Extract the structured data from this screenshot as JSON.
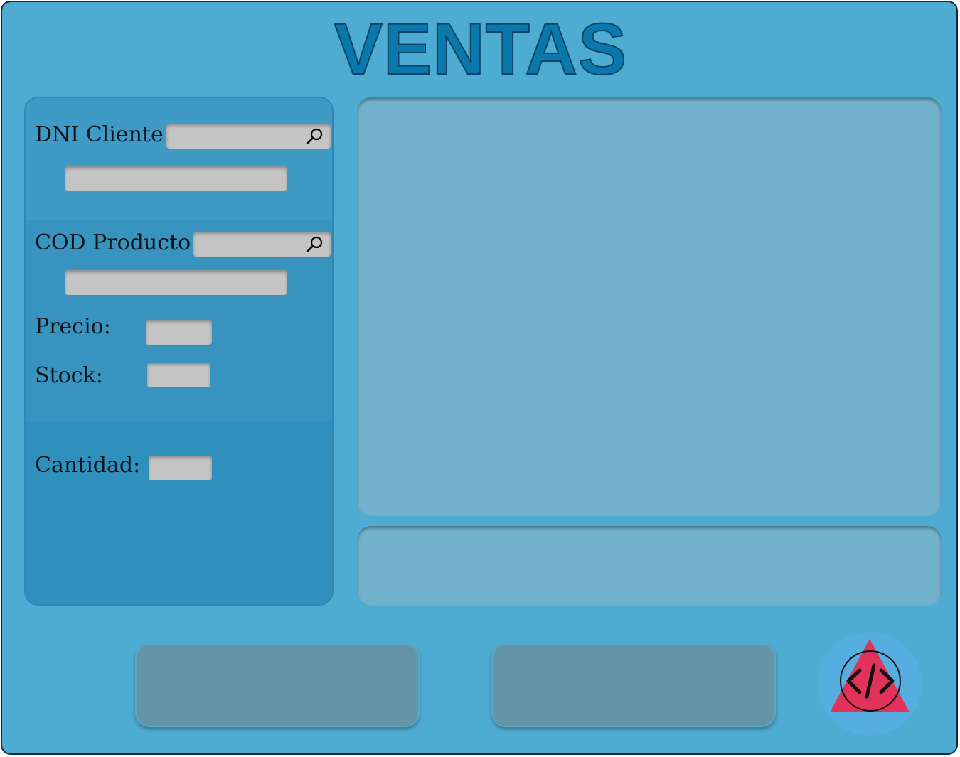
{
  "title": "VENTAS",
  "cliente": {
    "dni_label": "DNI Cliente:",
    "dni_value": "",
    "nombre_value": ""
  },
  "producto": {
    "cod_label": "COD Producto:",
    "cod_value": "",
    "descripcion_value": "",
    "precio_label": "Precio:",
    "precio_value": "",
    "stock_label": "Stock:",
    "stock_value": ""
  },
  "cantidad": {
    "label": "Cantidad:",
    "value": ""
  },
  "buttons": {
    "left_label": "",
    "right_label": ""
  },
  "icons": {
    "search": "search-icon",
    "logo": "code-triangle-logo"
  },
  "colors": {
    "background": "#4eabd1",
    "title": "#0a77ad",
    "panel": "#73b2cc",
    "field": "#c4c4c4",
    "button": "#6495a7",
    "logo_triangle": "#e0325a",
    "logo_circle_bg": "#55ade0"
  }
}
